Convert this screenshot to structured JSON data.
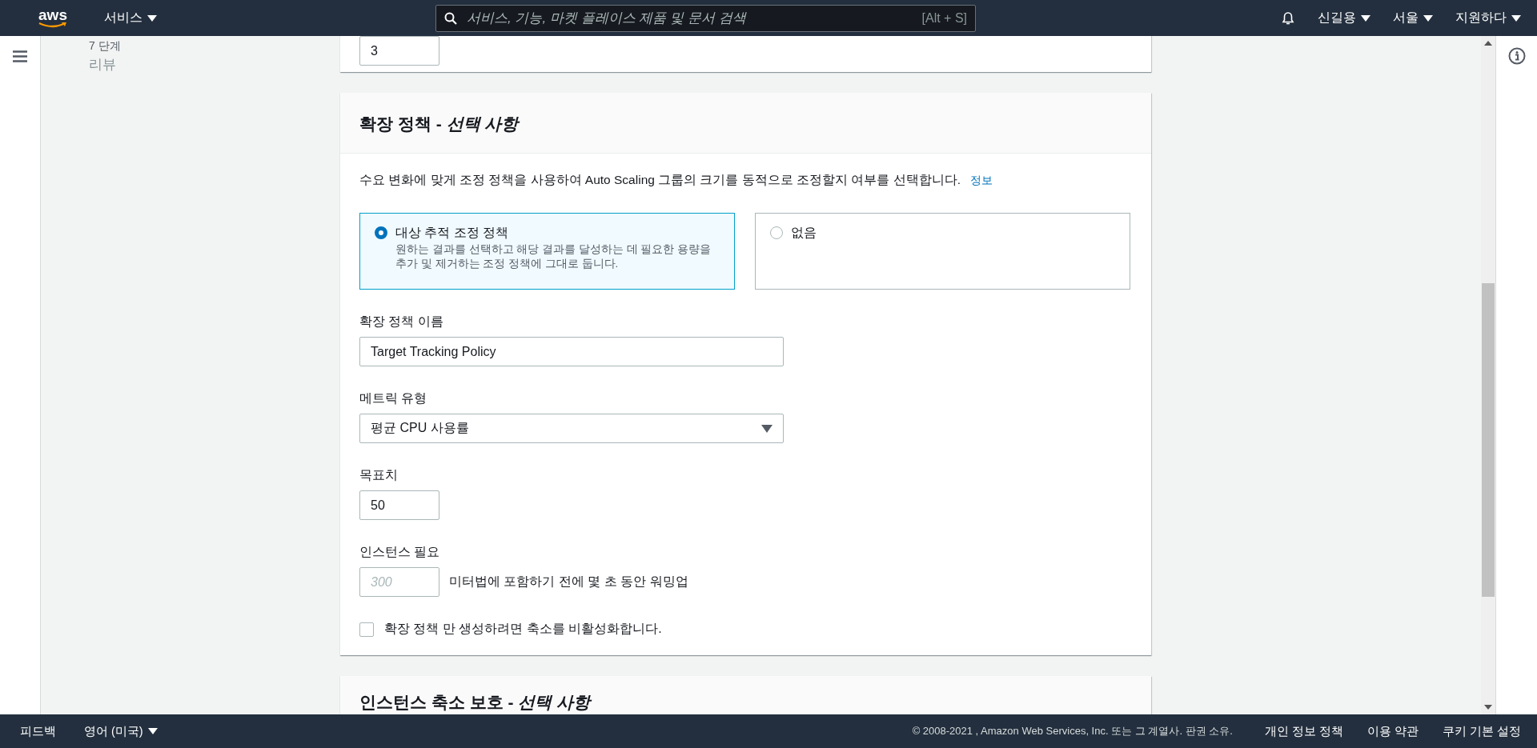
{
  "top_nav": {
    "logo": "aws",
    "services": "서비스",
    "search": {
      "placeholder": "서비스, 기능, 마켓 플레이스 제품 및 문서 검색",
      "shortcut": "[Alt + S]"
    },
    "account": "신길용",
    "region": "서울",
    "support": "지원하다"
  },
  "side_nav": {
    "steps": [
      {
        "step": "7 단계",
        "name": "리뷰"
      }
    ]
  },
  "previous_card": {
    "field_value": "3"
  },
  "scaling_card": {
    "title": "확장 정책 - *선택 사항*",
    "description": "수요 변화에 맞게 조정 정책을 사용하여 Auto Scaling 그룹의 크기를 동적으로 조정할지 여부를 선택합니다.",
    "info_link": "정보",
    "options": [
      {
        "label": "대상 추적 조정 정책",
        "description": "원하는 결과를 선택하고 해당 결과를 달성하는 데 필요한 용량을 추가 및 제거하는 조정 정책에 그대로 둡니다.",
        "selected": true
      },
      {
        "label": "없음",
        "selected": false
      }
    ],
    "policy_name": {
      "label": "확장 정책 이름",
      "value": "Target Tracking Policy"
    },
    "metric_type": {
      "label": "메트릭 유형",
      "value": "평균 CPU 사용률"
    },
    "target": {
      "label": "목표치",
      "value": "50"
    },
    "warmup": {
      "label": "인스턴스 필요",
      "placeholder": "300",
      "suffix": "미터법에 포함하기 전에 몇 초 동안 워밍업"
    },
    "disable_scale_in": {
      "label": "확장 정책 만 생성하려면 축소를 비활성화합니다.",
      "checked": false
    }
  },
  "next_card": {
    "title": "인스턴스 축소 보호 - *선택 사항*"
  },
  "footer": {
    "feedback": "피드백",
    "language": "영어 (미국)",
    "copyright": "© 2008-2021 , Amazon Web Services, Inc. 또는 그 계열사. 판권 소유.",
    "links": [
      "개인 정보 정책",
      "이용 약관",
      "쿠키 기본 설정"
    ]
  }
}
